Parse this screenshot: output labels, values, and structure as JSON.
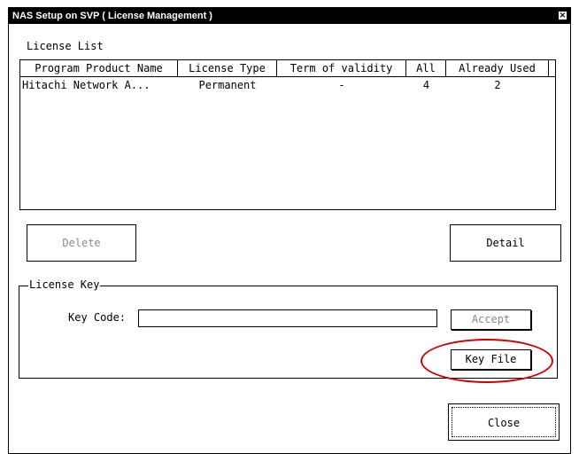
{
  "window": {
    "title": "NAS Setup on SVP ( License Management )",
    "close_glyph": "×"
  },
  "license_list": {
    "label": "License List",
    "columns": [
      "Program Product Name",
      "License Type",
      "Term of validity",
      "All",
      "Already Used"
    ],
    "rows": [
      {
        "name": "Hitachi Network A...",
        "type": "Permanent",
        "term": "-",
        "all": "4",
        "used": "2"
      }
    ]
  },
  "buttons": {
    "delete": "Delete",
    "detail": "Detail",
    "accept": "Accept",
    "key_file": "Key File",
    "close": "Close"
  },
  "license_key": {
    "group_label": "License Key",
    "key_code_label": "Key Code:",
    "key_code_value": ""
  },
  "colors": {
    "highlight": "#d00000",
    "disabled_text": "#8a8a8a"
  }
}
